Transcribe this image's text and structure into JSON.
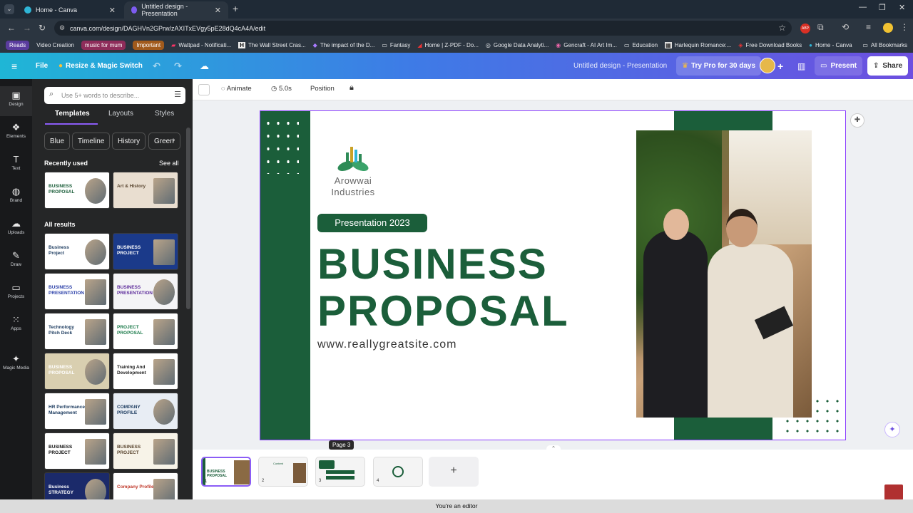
{
  "browser": {
    "tabs": [
      {
        "label": "Home - Canva",
        "active": false
      },
      {
        "label": "Untitled design - Presentation",
        "active": true
      }
    ],
    "url": "canva.com/design/DAGHVn2GPrw/zAXITxEVgy5pE28dQ4cA4A/edit",
    "bookmarks": [
      "Reads",
      "Video Creation",
      "music for mum",
      "Important",
      "Wattpad - Notificati...",
      "The Wall Street Cras...",
      "The impact of the D...",
      "Fantasy",
      "Home | Z-PDF - Do...",
      "Google Data Analyti...",
      "Gencraft - AI Art Im...",
      "Education",
      "Harlequin Romance:...",
      "Free Download Books",
      "Home - Canva",
      "All Bookmarks"
    ]
  },
  "header": {
    "file": "File",
    "resize": "Resize & Magic Switch",
    "doc_title": "Untitled design - Presentation",
    "try_pro": "Try Pro for 30 days",
    "present": "Present",
    "share": "Share"
  },
  "rail": [
    {
      "label": "Design",
      "icon": "design-icon"
    },
    {
      "label": "Elements",
      "icon": "elements-icon"
    },
    {
      "label": "Text",
      "icon": "text-icon"
    },
    {
      "label": "Brand",
      "icon": "brand-icon"
    },
    {
      "label": "Uploads",
      "icon": "uploads-icon"
    },
    {
      "label": "Draw",
      "icon": "draw-icon"
    },
    {
      "label": "Projects",
      "icon": "projects-icon"
    },
    {
      "label": "Apps",
      "icon": "apps-icon"
    },
    {
      "label": "Magic Media",
      "icon": "magic-media-icon"
    }
  ],
  "panel": {
    "search_placeholder": "Use 5+ words to describe...",
    "tabs": [
      "Templates",
      "Layouts",
      "Styles"
    ],
    "chips": [
      "Blue",
      "Timeline",
      "History",
      "Green"
    ],
    "recently_used": "Recently used",
    "see_all": "See all",
    "all_results": "All results",
    "recent_thumbs": [
      {
        "text": "BUSINESS PROPOSAL",
        "bg": "#ffffff",
        "fg": "#1b5e3a"
      },
      {
        "text": "Art & History",
        "bg": "#e9ded0",
        "fg": "#5a4630"
      }
    ],
    "results": [
      {
        "text": "Business Project",
        "bg": "#ffffff",
        "fg": "#1b3a5e"
      },
      {
        "text": "BUSINESS PROJECT",
        "bg": "#1b3a8a",
        "fg": "#ffffff"
      },
      {
        "text": "BUSINESS PRESENTATION",
        "bg": "#ffffff",
        "fg": "#2a3fa8"
      },
      {
        "text": "BUSINESS PRESENTATION",
        "bg": "#f4f4f6",
        "fg": "#5b2a9a"
      },
      {
        "text": "Technology Pitch Deck",
        "bg": "#ffffff",
        "fg": "#1b3a5e"
      },
      {
        "text": "PROJECT PROPOSAL",
        "bg": "#ffffff",
        "fg": "#1b7a4a"
      },
      {
        "text": "BUSINESS PROPOSAL",
        "bg": "#d9cfb0",
        "fg": "#ffffff"
      },
      {
        "text": "Training And Development",
        "bg": "#ffffff",
        "fg": "#222222"
      },
      {
        "text": "HR Performance Management",
        "bg": "#ffffff",
        "fg": "#1b3a5e"
      },
      {
        "text": "COMPANY PROFILE",
        "bg": "#e8edf4",
        "fg": "#1b3a5e"
      },
      {
        "text": "BUSINESS PROJECT",
        "bg": "#ffffff",
        "fg": "#111111"
      },
      {
        "text": "BUSINESS PROJECT",
        "bg": "#f7f3e8",
        "fg": "#5a4630"
      },
      {
        "text": "Business STRATEGY",
        "bg": "#1b2a6a",
        "fg": "#ffffff"
      },
      {
        "text": "Company Profile",
        "bg": "#ffffff",
        "fg": "#c0392b"
      }
    ]
  },
  "toolbar": {
    "animate": "Animate",
    "duration": "5.0s",
    "position": "Position"
  },
  "slide": {
    "company_line1": "Arowwai",
    "company_line2": "Industries",
    "badge": "Presentation 2023",
    "title_line1": "BUSINESS",
    "title_line2": "PROPOSAL",
    "website": "www.reallygreatsite.com",
    "accent": "#1b5e3a"
  },
  "pages": {
    "tooltip": "Page 3",
    "items": [
      "1",
      "2",
      "3",
      "4"
    ],
    "add_label": "+"
  },
  "status": "You're an editor"
}
